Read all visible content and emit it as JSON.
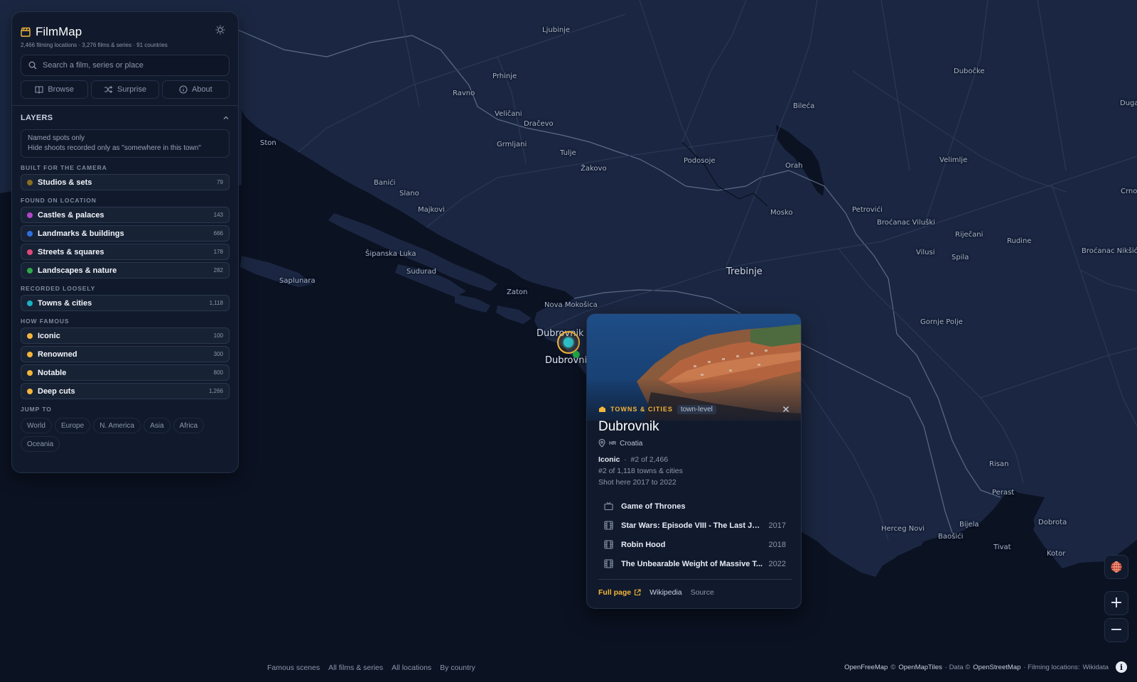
{
  "app": {
    "name": "FilmMap",
    "subtitle": "2,466 filming locations · 3,276 films & series · 91 countries"
  },
  "search": {
    "placeholder": "Search a film, series or place"
  },
  "nav_buttons": [
    {
      "label": "Browse",
      "icon": "book-icon"
    },
    {
      "label": "Surprise",
      "icon": "shuffle-icon"
    },
    {
      "label": "About",
      "icon": "info-icon"
    }
  ],
  "layers": {
    "title": "LAYERS",
    "named_spots": {
      "title": "Named spots only",
      "description": "Hide shoots recorded only as \"somewhere in this town\""
    },
    "groups": [
      {
        "label": "BUILT FOR THE CAMERA",
        "items": [
          {
            "label": "Studios & sets",
            "count": "79",
            "color": "#8a6d1e"
          }
        ]
      },
      {
        "label": "FOUND ON LOCATION",
        "items": [
          {
            "label": "Castles & palaces",
            "count": "143",
            "color": "#b146c8"
          },
          {
            "label": "Landmarks & buildings",
            "count": "666",
            "color": "#2f6fe0"
          },
          {
            "label": "Streets & squares",
            "count": "178",
            "color": "#e0487a"
          },
          {
            "label": "Landscapes & nature",
            "count": "282",
            "color": "#2ea84a"
          }
        ]
      },
      {
        "label": "RECORDED LOOSELY",
        "items": [
          {
            "label": "Towns & cities",
            "count": "1,118",
            "color": "#19b3c4"
          }
        ]
      },
      {
        "label": "HOW FAMOUS",
        "items": [
          {
            "label": "Iconic",
            "count": "100",
            "color": "#f5b53a"
          },
          {
            "label": "Renowned",
            "count": "300",
            "color": "#f5b53a"
          },
          {
            "label": "Notable",
            "count": "800",
            "color": "#f5b53a"
          },
          {
            "label": "Deep cuts",
            "count": "1,266",
            "color": "#f5b53a"
          }
        ]
      }
    ]
  },
  "jump_to": {
    "label": "JUMP TO",
    "regions": [
      "World",
      "Europe",
      "N. America",
      "Asia",
      "Africa",
      "Oceania"
    ]
  },
  "map_labels": [
    {
      "text": "Ljubinje",
      "size": "sm"
    },
    {
      "text": "Prhinje",
      "size": "sm"
    },
    {
      "text": "Ravno",
      "size": "sm"
    },
    {
      "text": "Veličani",
      "size": "sm"
    },
    {
      "text": "Dračevo",
      "size": "sm"
    },
    {
      "text": "Grmljani",
      "size": "sm"
    },
    {
      "text": "Tulje",
      "size": "sm"
    },
    {
      "text": "Žakovo",
      "size": "sm"
    },
    {
      "text": "Podosoje",
      "size": "sm"
    },
    {
      "text": "Orah",
      "size": "sm"
    },
    {
      "text": "Bileća",
      "size": "sm"
    },
    {
      "text": "Dubočke",
      "size": "sm"
    },
    {
      "text": "Duga",
      "size": "sm"
    },
    {
      "text": "Velimlje",
      "size": "sm"
    },
    {
      "text": "Crnoč",
      "size": "sm"
    },
    {
      "text": "Ston",
      "size": "sm"
    },
    {
      "text": "Banići",
      "size": "sm"
    },
    {
      "text": "Slano",
      "size": "sm"
    },
    {
      "text": "Majkovi",
      "size": "sm"
    },
    {
      "text": "Mosko",
      "size": "sm"
    },
    {
      "text": "Petrovići",
      "size": "sm"
    },
    {
      "text": "Broćanac Viluški",
      "size": "sm"
    },
    {
      "text": "Riječani",
      "size": "sm"
    },
    {
      "text": "Rudine",
      "size": "sm"
    },
    {
      "text": "Broćanac Nikšić",
      "size": "sm"
    },
    {
      "text": "Vilusi",
      "size": "sm"
    },
    {
      "text": "Spila",
      "size": "sm"
    },
    {
      "text": "Šipanska Luka",
      "size": "sm"
    },
    {
      "text": "Sudurad",
      "size": "sm"
    },
    {
      "text": "Saplunara",
      "size": "sm"
    },
    {
      "text": "Trebinje",
      "size": "lg"
    },
    {
      "text": "Zaton",
      "size": "sm"
    },
    {
      "text": "Nova Mokošica",
      "size": "sm"
    },
    {
      "text": "Dubrovnik",
      "size": "lg"
    },
    {
      "text": "Dubrovni",
      "size": "city"
    },
    {
      "text": "Gornje Polje",
      "size": "sm"
    },
    {
      "text": "Risan",
      "size": "sm"
    },
    {
      "text": "Perast",
      "size": "sm"
    },
    {
      "text": "Dobrota",
      "size": "sm"
    },
    {
      "text": "Kotor",
      "size": "sm"
    },
    {
      "text": "Bijela",
      "size": "sm"
    },
    {
      "text": "Baošići",
      "size": "sm"
    },
    {
      "text": "Tivat",
      "size": "sm"
    },
    {
      "text": "Herceg Novi",
      "size": "sm"
    }
  ],
  "popup": {
    "category": "TOWNS & CITIES",
    "badge": "town-level",
    "title": "Dubrovnik",
    "country_code": "HR",
    "country": "Croatia",
    "fame_tier": "Iconic",
    "rank_overall": "#2 of 2,466",
    "rank_category": "#2 of 1,118 towns & cities",
    "shot_years": "Shot here 2017 to 2022",
    "films": [
      {
        "title": "Game of Thrones",
        "year": "",
        "icon": "tv-icon"
      },
      {
        "title": "Star Wars: Episode VIII - The Last Jedi",
        "year": "2017",
        "icon": "film-icon"
      },
      {
        "title": "Robin Hood",
        "year": "2018",
        "icon": "film-icon"
      },
      {
        "title": "The Unbearable Weight of Massive T...",
        "year": "2022",
        "icon": "film-icon"
      }
    ],
    "links": {
      "full_page": "Full page",
      "wikipedia": "Wikipedia",
      "source": "Source"
    }
  },
  "controls": {
    "zoom_in": "+",
    "zoom_out": "−"
  },
  "footer": {
    "links": [
      "Famous scenes",
      "All films & series",
      "All locations",
      "By country"
    ],
    "attribution": {
      "openfreemap": "OpenFreeMap",
      "copy1": "©",
      "openmaptiles": "OpenMapTiles",
      "data_prefix": "· Data ©",
      "osm": "OpenStreetMap",
      "filming_prefix": "· Filming locations:",
      "wikidata": "Wikidata"
    }
  },
  "colors": {
    "accent": "#f5b53a",
    "land": "#1a2640",
    "sea": "#0b1222",
    "panel": "#111a2c"
  }
}
